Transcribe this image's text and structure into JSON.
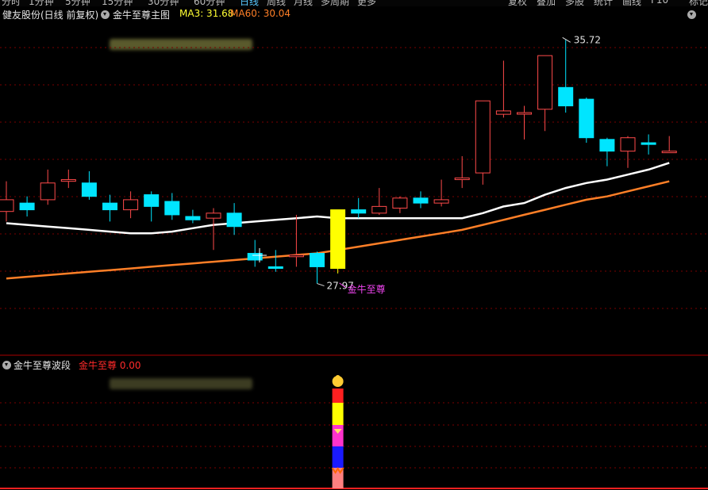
{
  "topbar": {
    "items": [
      "分时",
      "1分钟",
      "5分钟",
      "15分钟",
      "30分钟",
      "60分钟",
      "日线",
      "周线",
      "月线",
      "多周期",
      "更多"
    ],
    "active": "日线",
    "right_items": [
      "复权",
      "叠加",
      "多股",
      "统计",
      "画线",
      "F10",
      "标记"
    ]
  },
  "main_header": {
    "stock": "健友股份(日线 前复权)",
    "indicator": "金牛至尊主图",
    "ma3_label": "MA3: 31.68",
    "ma60_label": "MA60: 30.04",
    "ma3_color": "#ffffff",
    "ma60_color": "#ff7f27"
  },
  "sub_header": {
    "indicator": "金牛至尊波段",
    "value_label": "金牛至尊  0.00",
    "value_color": "#ff2a2a"
  },
  "annotations": {
    "high_label": "35.72",
    "low_label": "27.97",
    "signal_label": "金牛至尊"
  },
  "colors": {
    "up": "#ff4a4a",
    "down": "#00e5ff",
    "signal": "#ffff00",
    "grid": "#7a0000",
    "annotation": "#ee44ee"
  },
  "chart_data": {
    "type": "candlestick",
    "title": "健友股份(日线 前复权)",
    "price_range": [
      26.5,
      36.2
    ],
    "candles": [
      {
        "o": 30.6,
        "c": 30.95,
        "h": 31.5,
        "l": 30.3
      },
      {
        "o": 30.85,
        "c": 30.65,
        "h": 31.05,
        "l": 30.45
      },
      {
        "o": 30.95,
        "c": 31.45,
        "h": 31.85,
        "l": 30.8
      },
      {
        "o": 31.5,
        "c": 31.55,
        "h": 31.85,
        "l": 31.3
      },
      {
        "o": 31.45,
        "c": 31.05,
        "h": 31.8,
        "l": 30.95
      },
      {
        "o": 30.85,
        "c": 30.65,
        "h": 31.1,
        "l": 30.3
      },
      {
        "o": 30.65,
        "c": 30.95,
        "h": 31.2,
        "l": 30.4
      },
      {
        "o": 31.1,
        "c": 30.75,
        "h": 31.2,
        "l": 30.3
      },
      {
        "o": 30.9,
        "c": 30.5,
        "h": 31.15,
        "l": 30.35
      },
      {
        "o": 30.45,
        "c": 30.35,
        "h": 30.65,
        "l": 30.25
      },
      {
        "o": 30.4,
        "c": 30.55,
        "h": 30.7,
        "l": 29.45
      },
      {
        "o": 30.55,
        "c": 30.15,
        "h": 30.85,
        "l": 29.9
      },
      {
        "o": 29.35,
        "c": 29.15,
        "h": 29.75,
        "l": 28.95
      },
      {
        "o": 28.95,
        "c": 28.9,
        "h": 29.45,
        "l": 28.8
      },
      {
        "o": 29.25,
        "c": 29.3,
        "h": 30.5,
        "l": 28.95
      },
      {
        "o": 29.35,
        "c": 28.95,
        "h": 29.4,
        "l": 28.45
      },
      {
        "o": 28.9,
        "c": 30.65,
        "h": 30.65,
        "l": 28.75,
        "signal": true
      },
      {
        "o": 30.65,
        "c": 30.55,
        "h": 31.0,
        "l": 30.4
      },
      {
        "o": 30.55,
        "c": 30.75,
        "h": 31.3,
        "l": 30.5
      },
      {
        "o": 30.7,
        "c": 31.0,
        "h": 31.05,
        "l": 30.55
      },
      {
        "o": 31.0,
        "c": 30.85,
        "h": 31.2,
        "l": 30.7
      },
      {
        "o": 30.85,
        "c": 30.95,
        "h": 31.55,
        "l": 30.75
      },
      {
        "o": 31.55,
        "c": 31.6,
        "h": 32.25,
        "l": 31.3
      },
      {
        "o": 31.75,
        "c": 33.9,
        "h": 33.9,
        "l": 31.4
      },
      {
        "o": 33.5,
        "c": 33.6,
        "h": 35.1,
        "l": 33.4
      },
      {
        "o": 33.55,
        "c": 33.55,
        "h": 33.75,
        "l": 32.75
      },
      {
        "o": 33.65,
        "c": 35.25,
        "h": 35.25,
        "l": 33.0
      },
      {
        "o": 34.3,
        "c": 33.75,
        "h": 35.72,
        "l": 33.55
      },
      {
        "o": 33.95,
        "c": 32.8,
        "h": 34.0,
        "l": 32.65
      },
      {
        "o": 32.75,
        "c": 32.4,
        "h": 32.8,
        "l": 31.95
      },
      {
        "o": 32.4,
        "c": 32.8,
        "h": 32.85,
        "l": 31.9
      },
      {
        "o": 32.65,
        "c": 32.6,
        "h": 32.9,
        "l": 32.3
      },
      {
        "o": 32.4,
        "c": 32.4,
        "h": 32.85,
        "l": 32.4
      }
    ],
    "ma3": [
      30.25,
      30.2,
      30.15,
      30.1,
      30.05,
      30.0,
      29.95,
      29.95,
      30.0,
      30.1,
      30.2,
      30.25,
      30.3,
      30.35,
      30.4,
      30.45,
      30.4,
      30.4,
      30.4,
      30.4,
      30.4,
      30.4,
      30.4,
      30.55,
      30.75,
      30.85,
      31.1,
      31.3,
      31.45,
      31.55,
      31.7,
      31.85,
      32.05
    ],
    "ma60": [
      28.6,
      28.65,
      28.7,
      28.75,
      28.8,
      28.85,
      28.9,
      28.95,
      29.0,
      29.05,
      29.1,
      29.15,
      29.2,
      29.25,
      29.3,
      29.35,
      29.45,
      29.55,
      29.65,
      29.75,
      29.85,
      29.95,
      30.05,
      30.2,
      30.35,
      30.5,
      30.65,
      30.8,
      30.95,
      31.05,
      31.2,
      31.35,
      31.5
    ]
  }
}
